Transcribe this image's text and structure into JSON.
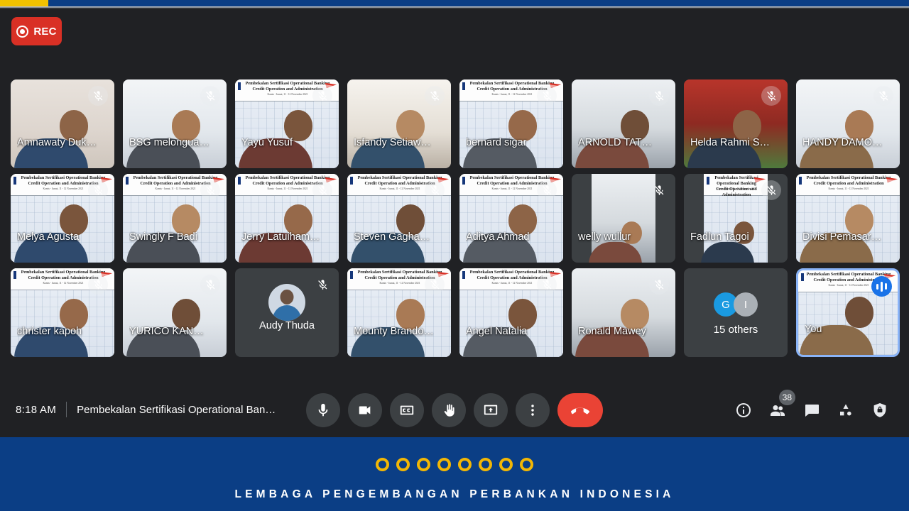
{
  "browser": {
    "accent_blue": "#0b3e85",
    "accent_yellow": "#f2c200"
  },
  "recording": {
    "label": "REC",
    "color": "#d93025"
  },
  "slide_background": {
    "line1": "Pembekalan Sertifikasi Operational Banking",
    "line2": "Credit Operation and Administration",
    "line3": "Kamis - Jumat, 11 - 12 November 2021"
  },
  "grid": {
    "rows": [
      [
        {
          "name": "Amnawaty Duk…",
          "muted": true,
          "kind": "video",
          "bg": "room-a"
        },
        {
          "name": "BSG melongua…",
          "muted": true,
          "kind": "video",
          "bg": "room-b"
        },
        {
          "name": "Yayu Yusuf",
          "muted": true,
          "kind": "slide",
          "bg": "room-c"
        },
        {
          "name": "Isfandy Setiaw…",
          "muted": true,
          "kind": "video",
          "bg": "room-f"
        },
        {
          "name": "bernard sigar",
          "muted": true,
          "kind": "slide",
          "bg": "room-e"
        },
        {
          "name": "ARNOLD TATE…",
          "muted": true,
          "kind": "video",
          "bg": "room-e"
        },
        {
          "name": "Helda Rahmi Si…",
          "muted": true,
          "kind": "video",
          "bg": "room-d"
        },
        {
          "name": "HANDY DAMO…",
          "muted": true,
          "kind": "video",
          "bg": "room-b"
        }
      ],
      [
        {
          "name": "Melya Agusta",
          "muted": true,
          "kind": "slide",
          "bg": "room-c"
        },
        {
          "name": "Swingly F Badi",
          "muted": true,
          "kind": "slide",
          "bg": "room-c"
        },
        {
          "name": "Jerry Latuiham…",
          "muted": true,
          "kind": "slide",
          "bg": "room-c"
        },
        {
          "name": "Steven Gaghau…",
          "muted": true,
          "kind": "slide",
          "bg": "room-c"
        },
        {
          "name": "Aditya Ahmad",
          "muted": true,
          "kind": "slide",
          "bg": "room-c"
        },
        {
          "name": "welly wullur",
          "muted": true,
          "kind": "portrait",
          "bg": "room-e"
        },
        {
          "name": "Fadlun Tagoi",
          "muted": true,
          "kind": "portrait-slide",
          "bg": "room-c"
        },
        {
          "name": "Divisi Pemasar…",
          "muted": false,
          "kind": "slide",
          "bg": "room-c"
        }
      ],
      [
        {
          "name": "christer kapoh",
          "muted": true,
          "kind": "slide",
          "bg": "room-c"
        },
        {
          "name": "YURICO KAND…",
          "muted": true,
          "kind": "video",
          "bg": "room-b"
        },
        {
          "name": "Audy Thuda",
          "muted": true,
          "kind": "avatar",
          "bg": ""
        },
        {
          "name": "Mounty Brando…",
          "muted": true,
          "kind": "slide",
          "bg": "room-c"
        },
        {
          "name": "Angel Natalia",
          "muted": true,
          "kind": "slide",
          "bg": "room-c"
        },
        {
          "name": "Ronald Mawey",
          "muted": true,
          "kind": "video",
          "bg": "room-e"
        },
        {
          "name": "15 others",
          "muted": false,
          "kind": "others",
          "bg": "",
          "avatars": [
            {
              "letter": "G",
              "color": "blue"
            },
            {
              "letter": "I",
              "color": "gray"
            }
          ]
        },
        {
          "name": "You",
          "muted": false,
          "kind": "self",
          "bg": "room-c",
          "speaking": true
        }
      ]
    ]
  },
  "bottombar": {
    "clock": "8:18 AM",
    "meeting_title": "Pembekalan Sertifikasi Operational Ban…",
    "controls": [
      {
        "icon": "microphone-icon",
        "label": "Turn off microphone"
      },
      {
        "icon": "camera-icon",
        "label": "Turn off camera"
      },
      {
        "icon": "closed-captions-icon",
        "label": "Turn on captions"
      },
      {
        "icon": "raise-hand-icon",
        "label": "Raise hand"
      },
      {
        "icon": "present-screen-icon",
        "label": "Present now"
      },
      {
        "icon": "more-options-icon",
        "label": "More options"
      },
      {
        "icon": "hangup-icon",
        "label": "Leave call"
      }
    ],
    "right_controls": [
      {
        "icon": "info-icon",
        "label": "Meeting details",
        "badge": ""
      },
      {
        "icon": "people-icon",
        "label": "Show everyone",
        "badge": "38"
      },
      {
        "icon": "chat-icon",
        "label": "Chat with everyone",
        "badge": ""
      },
      {
        "icon": "activities-icon",
        "label": "Activities",
        "badge": ""
      },
      {
        "icon": "host-controls-icon",
        "label": "Host controls",
        "badge": ""
      }
    ]
  },
  "footer_banner": {
    "text": "LEMBAGA PENGEMBANGAN PERBANKAN INDONESIA",
    "ring_count": 8,
    "bg_color": "#0b3e85",
    "ring_color": "#f2b705"
  }
}
